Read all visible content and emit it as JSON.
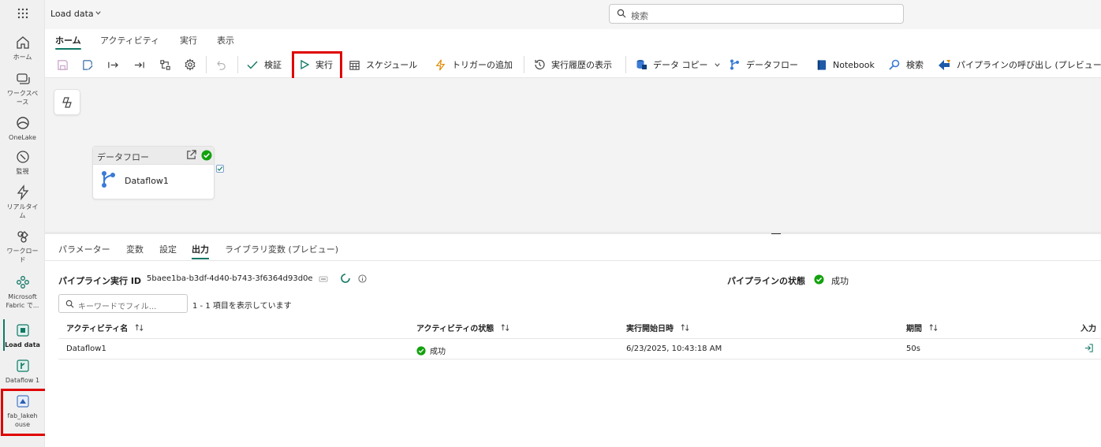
{
  "rail": {
    "items": [
      {
        "label": "ホーム"
      },
      {
        "label": "ワークスペース"
      },
      {
        "label": "OneLake"
      },
      {
        "label": "監視"
      },
      {
        "label": "リアルタイム"
      },
      {
        "label": "ワークロード"
      },
      {
        "label": "Microsoft Fabric で..."
      },
      {
        "label": "Load data"
      },
      {
        "label": "Dataflow 1"
      },
      {
        "label": "fab_lakehouse"
      }
    ]
  },
  "header": {
    "title": "Load data",
    "search_placeholder": "検索"
  },
  "tabs": [
    "ホーム",
    "アクティビティ",
    "実行",
    "表示"
  ],
  "toolbar": {
    "validate": "検証",
    "run": "実行",
    "schedule": "スケジュール",
    "add_trigger": "トリガーの追加",
    "view_history": "実行履歴の表示",
    "copy_data": "データ コピー",
    "dataflow": "データフロー",
    "notebook": "Notebook",
    "search": "検索",
    "invoke_pipeline": "パイプラインの呼び出し (プレビュー"
  },
  "canvas": {
    "node": {
      "type": "データフロー",
      "name": "Dataflow1"
    }
  },
  "panel": {
    "tabs": [
      "パラメーター",
      "変数",
      "設定",
      "出力",
      "ライブラリ変数 (プレビュー)"
    ],
    "run_id_label": "パイプライン実行 ID",
    "run_id": "5baee1ba-b3df-4d40-b743-3f6364d93d0e",
    "status_label": "パイプラインの状態",
    "status": "成功",
    "filter_placeholder": "キーワードでフィル...",
    "count_text": "1 - 1 項目を表示しています",
    "columns": [
      "アクティビティ名",
      "アクティビティの状態",
      "実行開始日時",
      "期間",
      "入力"
    ],
    "rows": [
      {
        "name": "Dataflow1",
        "status": "成功",
        "start": "6/23/2025, 10:43:18 AM",
        "duration": "50s"
      }
    ]
  },
  "colors": {
    "accent": "#117865",
    "success": "#13a10e",
    "highlight": "#e00000"
  }
}
